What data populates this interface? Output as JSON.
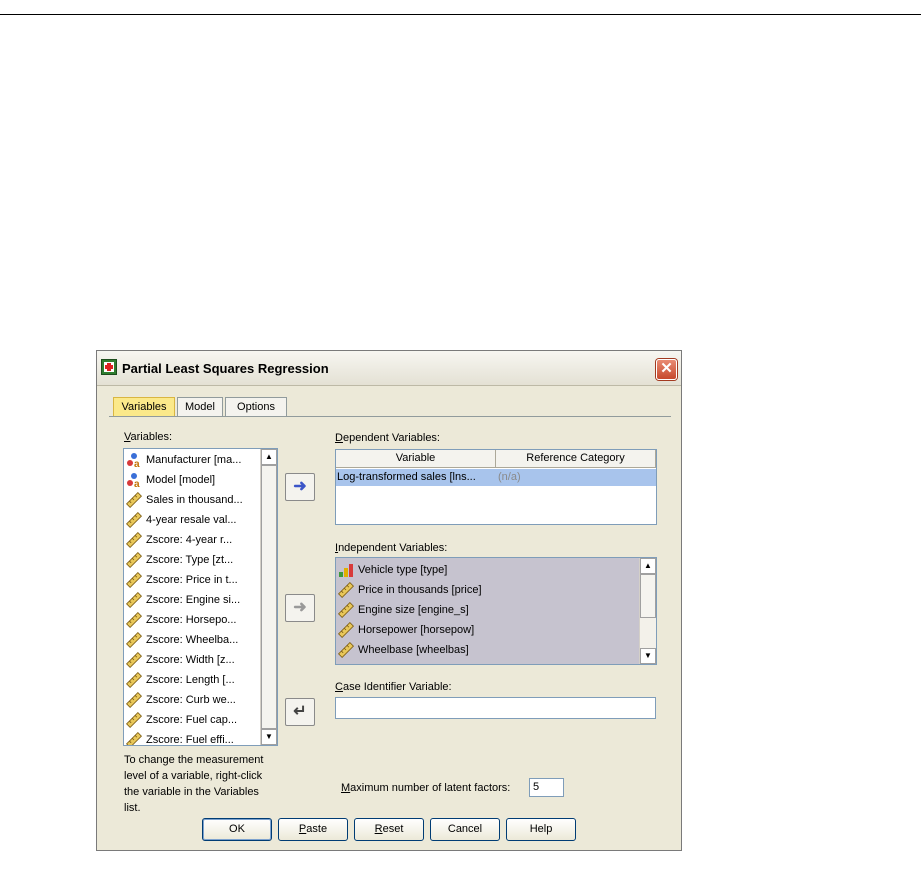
{
  "dialog": {
    "title": "Partial Least Squares Regression",
    "close_glyph": "✕"
  },
  "tabs": [
    {
      "label": "Variables",
      "active": true
    },
    {
      "label": "Model",
      "active": false
    },
    {
      "label": "Options",
      "active": false
    }
  ],
  "variables": {
    "label_prefix": "V",
    "label_rest": "ariables:",
    "items": [
      {
        "label": "Manufacturer [ma...",
        "icon": "nominal-string-icon"
      },
      {
        "label": "Model [model]",
        "icon": "nominal-string-icon"
      },
      {
        "label": "Sales in thousand...",
        "icon": "scale-ruler-icon"
      },
      {
        "label": "4-year resale val...",
        "icon": "scale-ruler-icon"
      },
      {
        "label": "Zscore:  4-year r...",
        "icon": "scale-ruler-icon"
      },
      {
        "label": "Zscore:  Type [zt...",
        "icon": "scale-ruler-icon"
      },
      {
        "label": "Zscore:  Price in t...",
        "icon": "scale-ruler-icon"
      },
      {
        "label": "Zscore:  Engine si...",
        "icon": "scale-ruler-icon"
      },
      {
        "label": "Zscore:  Horsepo...",
        "icon": "scale-ruler-icon"
      },
      {
        "label": "Zscore:  Wheelba...",
        "icon": "scale-ruler-icon"
      },
      {
        "label": "Zscore:  Width [z...",
        "icon": "scale-ruler-icon"
      },
      {
        "label": "Zscore:  Length [...",
        "icon": "scale-ruler-icon"
      },
      {
        "label": "Zscore:  Curb we...",
        "icon": "scale-ruler-icon"
      },
      {
        "label": "Zscore:  Fuel cap...",
        "icon": "scale-ruler-icon"
      },
      {
        "label": "Zscore:  Fuel effi...",
        "icon": "scale-ruler-icon"
      }
    ]
  },
  "dependent": {
    "label_prefix": "D",
    "label_rest": "ependent Variables:",
    "col_variable": "Variable",
    "col_reference": "Reference Category",
    "row_variable": "Log-transformed sales [lns...",
    "row_reference": "(n/a)"
  },
  "independent": {
    "label_prefix": "I",
    "label_rest": "ndependent Variables:",
    "items": [
      {
        "label": "Vehicle type [type]",
        "icon": "nominal-bar-icon"
      },
      {
        "label": "Price in thousands [price]",
        "icon": "scale-ruler-icon"
      },
      {
        "label": "Engine size [engine_s]",
        "icon": "scale-ruler-icon"
      },
      {
        "label": "Horsepower [horsepow]",
        "icon": "scale-ruler-icon"
      },
      {
        "label": "Wheelbase [wheelbas]",
        "icon": "scale-ruler-icon"
      }
    ]
  },
  "case_identifier": {
    "label_prefix": "C",
    "label_rest": "ase Identifier Variable:",
    "value": ""
  },
  "hint": "To change the measurement level of a variable, right-click the variable in the Variables list.",
  "max_factors": {
    "label_prefix": "M",
    "label_rest": "aximum number of latent factors:",
    "value": "5"
  },
  "buttons": {
    "ok": "OK",
    "paste_prefix": "P",
    "paste_rest": "aste",
    "reset_prefix": "R",
    "reset_rest": "eset",
    "cancel": "Cancel",
    "help": "Help"
  },
  "colors": {
    "accent_tab": "#fbe98a",
    "selection": "#a8c4ec",
    "arrow_blue": "#3b55c8"
  }
}
